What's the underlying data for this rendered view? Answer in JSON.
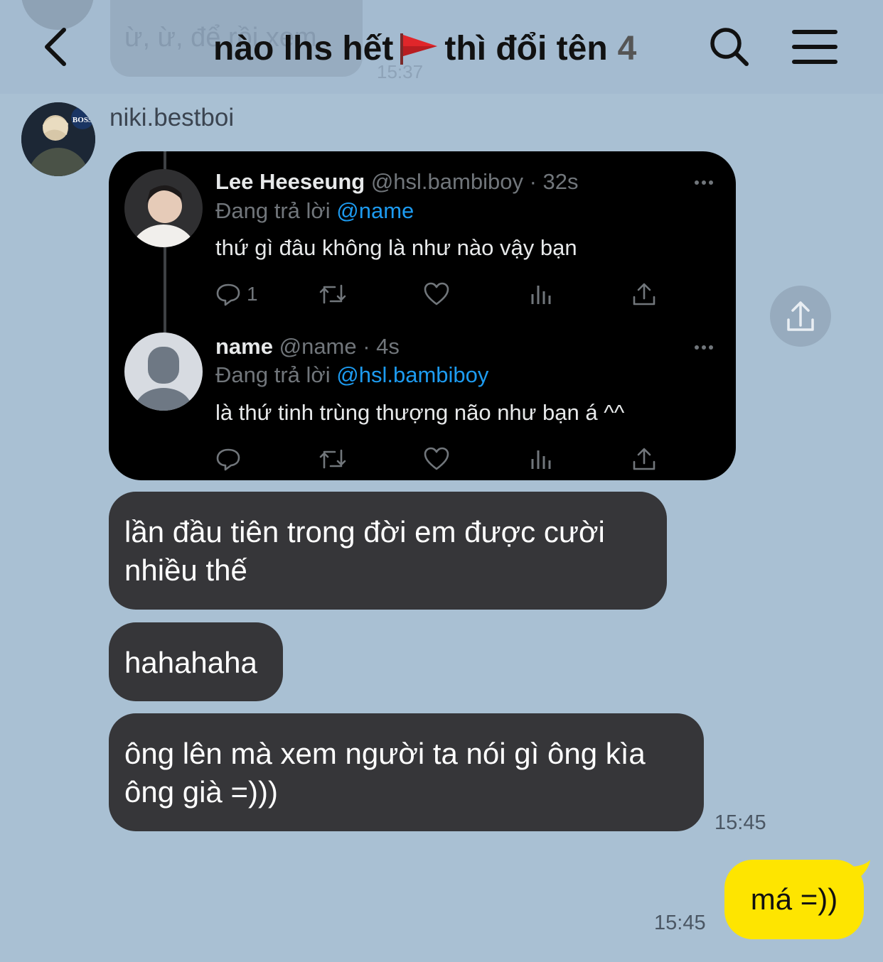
{
  "header": {
    "title_part1": "nào lhs hết",
    "title_part2": "thì đổi tên",
    "member_count": "4",
    "flag_icon": "red-flag-icon"
  },
  "ghost_previous": {
    "text": "ừ, ừ, để rồi xem",
    "time": "15:37"
  },
  "sender": {
    "name": "niki.bestboi"
  },
  "tweet_card": {
    "tweet1": {
      "display_name": "Lee Heeseung",
      "handle_time": "@hsl.bambiboy · 32s",
      "replying_label": "Đang trả lời",
      "replying_to": "@name",
      "text": "thứ gì đâu không là như nào vậy bạn",
      "reply_count": "1"
    },
    "tweet2": {
      "display_name": "name",
      "handle_time": "@name · 4s",
      "replying_label": "Đang trả lời",
      "replying_to": "@hsl.bambiboy",
      "text": "là thứ tinh trùng thượng não như bạn á ^^"
    }
  },
  "messages": [
    {
      "text": "lần đầu tiên trong đời em được cười nhiều thế"
    },
    {
      "text": "hahahaha"
    },
    {
      "text": "ông lên mà xem người ta nói gì ông kìa ông già =)))",
      "time": "15:45"
    }
  ],
  "my_message": {
    "text": "má =))",
    "time": "15:45"
  },
  "colors": {
    "chat_background": "#a9c0d3",
    "incoming_bubble": "#363639",
    "outgoing_bubble": "#fee500",
    "tweet_mention": "#1d9bf0"
  }
}
